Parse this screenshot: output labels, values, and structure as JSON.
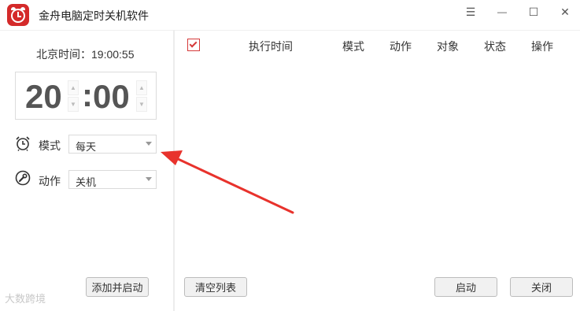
{
  "window": {
    "title": "金舟电脑定时关机软件",
    "controls": {
      "menu": "☰",
      "minimize": "—",
      "maximize": "☐",
      "close": "✕"
    }
  },
  "left_panel": {
    "beijing_time_label": "北京时间：19:00:55",
    "time_picker": {
      "hour": "20",
      "separator": ":",
      "minute": "00"
    },
    "mode": {
      "label": "模式",
      "value": "每天",
      "icon": "alarm-clock-icon"
    },
    "action": {
      "label": "动作",
      "value": "关机",
      "icon": "wrench-icon"
    },
    "add_button": "添加并启动"
  },
  "task_table": {
    "select_all_checked": true,
    "columns": [
      "执行时间",
      "模式",
      "动作",
      "对象",
      "状态",
      "操作"
    ],
    "rows": []
  },
  "footer": {
    "clear_button": "清空列表",
    "start_button": "启动",
    "close_button": "关闭"
  },
  "watermark": "大数跨境",
  "colors": {
    "brand": "#d42a2a",
    "checkbox": "#d53a3a",
    "annotation_arrow": "#e8322c"
  }
}
